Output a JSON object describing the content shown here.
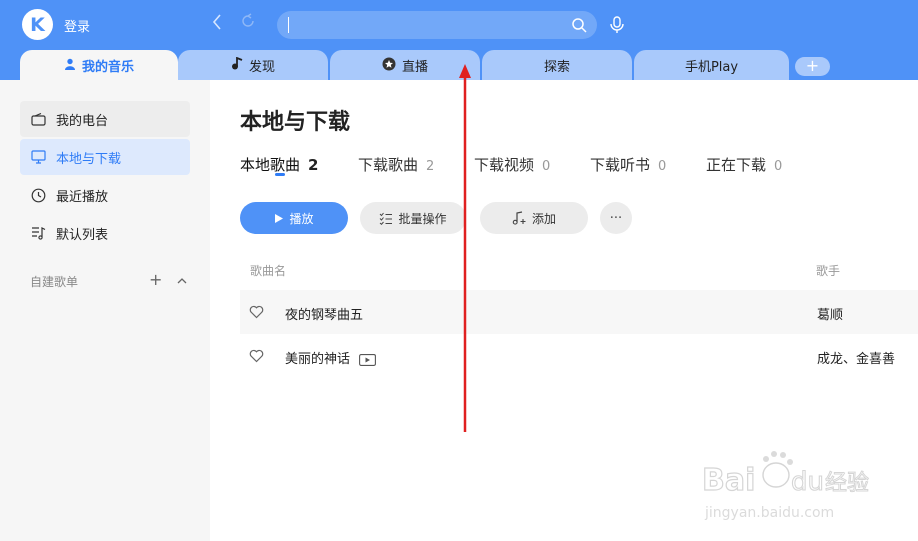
{
  "header": {
    "logo_letter": "K",
    "login_label": "登录",
    "search_placeholder": ""
  },
  "tabs": [
    {
      "label": "我的音乐",
      "icon": "person-icon",
      "active": true
    },
    {
      "label": "发现",
      "icon": "music-note-icon"
    },
    {
      "label": "直播",
      "icon": "star-icon"
    },
    {
      "label": "探索"
    },
    {
      "label": "手机Play"
    }
  ],
  "tab_add_label": "+",
  "sidebar": {
    "items": [
      {
        "label": "我的电台",
        "icon": "radio-icon"
      },
      {
        "label": "本地与下载",
        "icon": "monitor-icon",
        "active": true
      },
      {
        "label": "最近播放",
        "icon": "clock-icon"
      },
      {
        "label": "默认列表",
        "icon": "playlist-icon"
      }
    ],
    "section_label": "自建歌单",
    "section_add": "+"
  },
  "main": {
    "title": "本地与下载",
    "subtabs": [
      {
        "label": "本地歌曲",
        "count": "2",
        "active": true
      },
      {
        "label": "下载歌曲",
        "count": "2"
      },
      {
        "label": "下载视频",
        "count": "0"
      },
      {
        "label": "下载听书",
        "count": "0"
      },
      {
        "label": "正在下载",
        "count": "0"
      }
    ],
    "buttons": {
      "play": "播放",
      "batch": "批量操作",
      "add": "添加",
      "more": "···"
    },
    "columns": {
      "song": "歌曲名",
      "artist": "歌手"
    },
    "songs": [
      {
        "title": "夜的钢琴曲五",
        "artist": "葛顺",
        "has_mv": false
      },
      {
        "title": "美丽的神话",
        "artist": "成龙、金喜善",
        "has_mv": true
      }
    ]
  },
  "watermark": {
    "brand": "Baidu经验",
    "url": "jingyan.baidu.com"
  },
  "colors": {
    "accent": "#4f92f7",
    "annotation": "#e02020"
  }
}
